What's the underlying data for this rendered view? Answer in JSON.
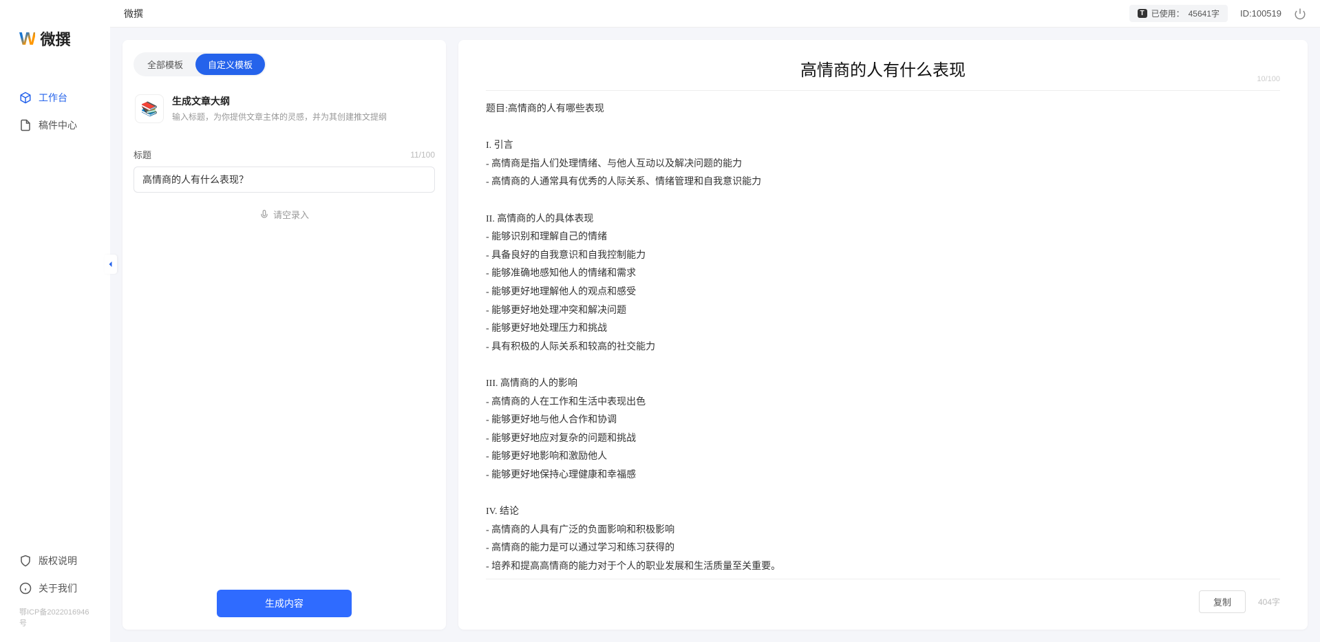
{
  "branding": {
    "name": "微撰"
  },
  "sidebar": {
    "nav": [
      {
        "label": "工作台",
        "active": true
      },
      {
        "label": "稿件中心",
        "active": false
      }
    ],
    "bottom": [
      {
        "label": "版权说明"
      },
      {
        "label": "关于我们"
      }
    ],
    "footer": "鄂ICP备2022016946号"
  },
  "topbar": {
    "title": "微撰",
    "usage_badge": "T",
    "usage_label": "已使用：",
    "usage_value": "45641字",
    "id_label": "ID:100519"
  },
  "left": {
    "tabs": [
      {
        "label": "全部模板",
        "active": false
      },
      {
        "label": "自定义模板",
        "active": true
      }
    ],
    "template": {
      "title": "生成文章大纲",
      "desc": "输入标题，为你提供文章主体的灵感，并为其创建推文提纲"
    },
    "field_label": "标题",
    "char_count": "11/100",
    "title_value": "高情商的人有什么表现？",
    "voice_label": "请空录入",
    "generate_label": "生成内容"
  },
  "right": {
    "title": "高情商的人有什么表现",
    "title_counter": "10/100",
    "body": "题目:高情商的人有哪些表现\n\nI. 引言\n- 高情商是指人们处理情绪、与他人互动以及解决问题的能力\n- 高情商的人通常具有优秀的人际关系、情绪管理和自我意识能力\n\nII. 高情商的人的具体表现\n- 能够识别和理解自己的情绪\n- 具备良好的自我意识和自我控制能力\n- 能够准确地感知他人的情绪和需求\n- 能够更好地理解他人的观点和感受\n- 能够更好地处理冲突和解决问题\n- 能够更好地处理压力和挑战\n- 具有积极的人际关系和较高的社交能力\n\nIII. 高情商的人的影响\n- 高情商的人在工作和生活中表现出色\n- 能够更好地与他人合作和协调\n- 能够更好地应对复杂的问题和挑战\n- 能够更好地影响和激励他人\n- 能够更好地保持心理健康和幸福感\n\nIV. 结论\n- 高情商的人具有广泛的负面影响和积极影响\n- 高情商的能力是可以通过学习和练习获得的\n- 培养和提高高情商的能力对于个人的职业发展和生活质量至关重要。",
    "copy_label": "复制",
    "word_count": "404字"
  }
}
